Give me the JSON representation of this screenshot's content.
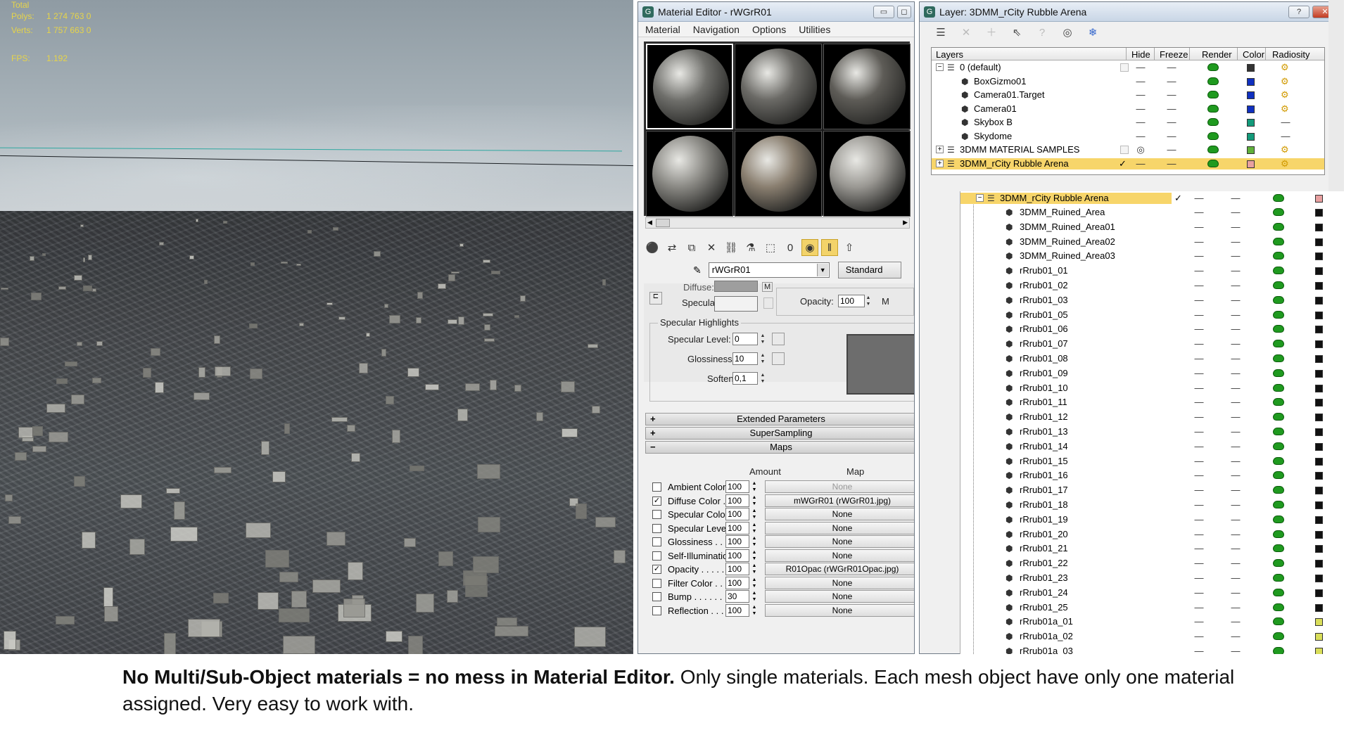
{
  "viewport": {
    "stats_header": "Total",
    "stats": [
      {
        "label": "Polys:",
        "value": "1 274 763",
        "extra": "0"
      },
      {
        "label": "Verts:",
        "value": "1 757 663",
        "extra": "0"
      },
      {
        "label": "FPS:",
        "value": "1.192",
        "extra": ""
      }
    ]
  },
  "material_editor": {
    "title": "Material Editor - rWGrR01",
    "menu": [
      "Material",
      "Navigation",
      "Options",
      "Utilities"
    ],
    "slot_colors": [
      "#6f6f6b",
      "#6b6a66",
      "#5e5c57",
      "#8a8984",
      "#8a7f70",
      "#9a9893"
    ],
    "material_name": "rWGrR01",
    "type_button": "Standard",
    "labels": {
      "diffuse": "Diffuse:",
      "specular": "Specular:",
      "m": "M",
      "opacity": "Opacity:",
      "opacity_value": "100",
      "specular_highlights": "Specular Highlights",
      "specular_level": "Specular Level:",
      "specular_level_value": "0",
      "glossiness": "Glossiness:",
      "glossiness_value": "10",
      "soften": "Soften:",
      "soften_value": "0,1"
    },
    "sections": [
      "Extended Parameters",
      "SuperSampling",
      "Maps"
    ],
    "maps_header": {
      "amount": "Amount",
      "map": "Map"
    },
    "maps": [
      {
        "name": "Ambient Color . . .",
        "checked": false,
        "amount": "100",
        "map": "None",
        "dim": true
      },
      {
        "name": "Diffuse Color . . . .",
        "checked": true,
        "amount": "100",
        "map": "mWGrR01 (rWGrR01.jpg)",
        "dim": false
      },
      {
        "name": "Specular Color",
        "checked": false,
        "amount": "100",
        "map": "None",
        "dim": false
      },
      {
        "name": "Specular Level",
        "checked": false,
        "amount": "100",
        "map": "None",
        "dim": false
      },
      {
        "name": "Glossiness . . . . .",
        "checked": false,
        "amount": "100",
        "map": "None",
        "dim": false
      },
      {
        "name": "Self-Illumination .",
        "checked": false,
        "amount": "100",
        "map": "None",
        "dim": false
      },
      {
        "name": "Opacity . . . . . . .",
        "checked": true,
        "amount": "100",
        "map": "R01Opac (rWGrR01Opac.jpg)",
        "dim": false
      },
      {
        "name": "Filter Color . . . . .",
        "checked": false,
        "amount": "100",
        "map": "None",
        "dim": false
      },
      {
        "name": "Bump . . . . . . . . .",
        "checked": false,
        "amount": "30",
        "map": "None",
        "dim": false
      },
      {
        "name": "Reflection . . . . .",
        "checked": false,
        "amount": "100",
        "map": "None",
        "dim": false
      }
    ]
  },
  "layer_manager": {
    "title": "Layer: 3DMM_rCity Rubble Arena",
    "help_btn": "?",
    "close_btn": "✕",
    "columns": [
      "Layers",
      "Hide",
      "Freeze",
      "Render",
      "Color",
      "Radiosity"
    ],
    "rows": [
      {
        "name": "0 (default)",
        "level": 0,
        "expander": "⊟",
        "color": "#333333",
        "kind": "layer"
      },
      {
        "name": "BoxGizmo01",
        "level": 1,
        "color": "#1030c0",
        "kind": "obj"
      },
      {
        "name": "Camera01.Target",
        "level": 1,
        "color": "#1030c0",
        "kind": "obj"
      },
      {
        "name": "Camera01",
        "level": 1,
        "color": "#1030c0",
        "kind": "obj"
      },
      {
        "name": "Skybox B",
        "level": 1,
        "color": "#139a7a",
        "kind": "obj"
      },
      {
        "name": "Skydome",
        "level": 1,
        "color": "#139a7a",
        "kind": "obj"
      },
      {
        "name": "3DMM MATERIAL SAMPLES",
        "level": 0,
        "expander": "⊞",
        "color": "#5fb03a",
        "kind": "layer"
      },
      {
        "name": "3DMM_rCity Rubble Arena",
        "level": 0,
        "expander": "⊞",
        "color": "#e8a0a0",
        "kind": "layer",
        "selected": true
      }
    ],
    "sub_header": "3DMM_rCity Rubble Arena",
    "sub_items": [
      "3DMM_Ruined_Area",
      "3DMM_Ruined_Area01",
      "3DMM_Ruined_Area02",
      "3DMM_Ruined_Area03",
      "rRrub01_01",
      "rRrub01_02",
      "rRrub01_03",
      "rRrub01_05",
      "rRrub01_06",
      "rRrub01_07",
      "rRrub01_08",
      "rRrub01_09",
      "rRrub01_10",
      "rRrub01_11",
      "rRrub01_12",
      "rRrub01_13",
      "rRrub01_14",
      "rRrub01_15",
      "rRrub01_16",
      "rRrub01_17",
      "rRrub01_18",
      "rRrub01_19",
      "rRrub01_20",
      "rRrub01_21",
      "rRrub01_22",
      "rRrub01_23",
      "rRrub01_24",
      "rRrub01_25",
      "rRrub01a_01",
      "rRrub01a_02",
      "rRrub01a_03"
    ]
  },
  "caption": {
    "bold": "No Multi/Sub-Object materials = no mess in Material Editor.",
    "rest": " Only single materials. Each mesh object have only one material assigned. Very easy to work with."
  }
}
